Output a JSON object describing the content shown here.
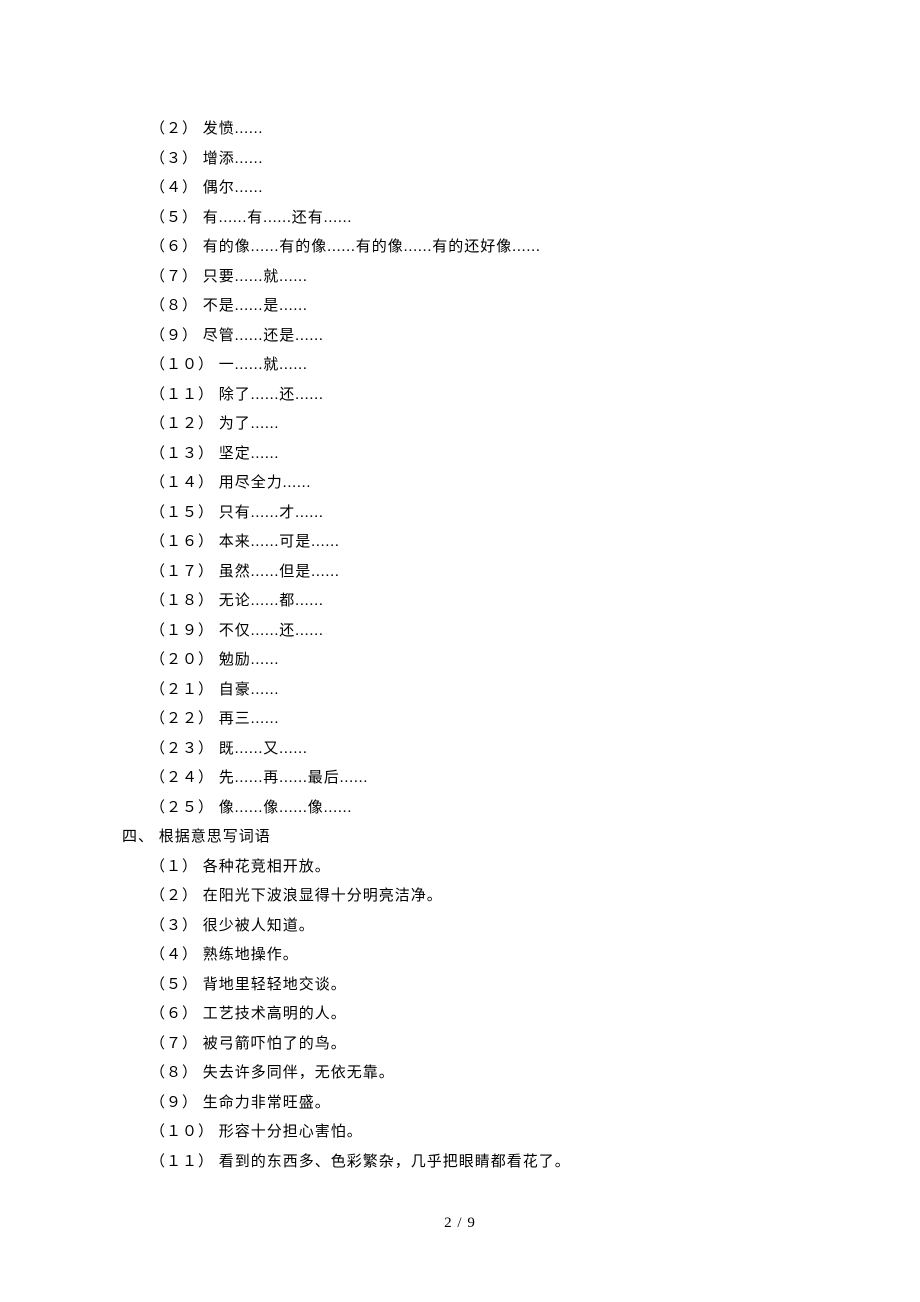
{
  "section1": {
    "items": [
      {
        "num": "（２）",
        "text": "发愤......"
      },
      {
        "num": "（３）",
        "text": "增添......"
      },
      {
        "num": "（４）",
        "text": "偶尔......"
      },
      {
        "num": "（５）",
        "text": "有......有......还有......"
      },
      {
        "num": "（６）",
        "text": "有的像......有的像......有的像......有的还好像......"
      },
      {
        "num": "（７）",
        "text": "只要......就......"
      },
      {
        "num": "（８）",
        "text": "不是......是......"
      },
      {
        "num": "（９）",
        "text": "尽管......还是......"
      },
      {
        "num": "（１０）",
        "text": "一......就......"
      },
      {
        "num": "（１１）",
        "text": "除了......还......"
      },
      {
        "num": "（１２）",
        "text": "为了......"
      },
      {
        "num": "（１３）",
        "text": "坚定......"
      },
      {
        "num": "（１４）",
        "text": "用尽全力......"
      },
      {
        "num": "（１５）",
        "text": "只有......才......"
      },
      {
        "num": "（１６）",
        "text": "本来......可是......"
      },
      {
        "num": "（１７）",
        "text": "虽然......但是......"
      },
      {
        "num": "（１８）",
        "text": "无论......都......"
      },
      {
        "num": "（１９）",
        "text": "不仅......还......"
      },
      {
        "num": "（２０）",
        "text": "勉励......"
      },
      {
        "num": "（２１）",
        "text": "自豪......"
      },
      {
        "num": "（２２）",
        "text": "再三......"
      },
      {
        "num": "（２３）",
        "text": "既......又......"
      },
      {
        "num": "（２４）",
        "text": "先......再......最后......"
      },
      {
        "num": "（２５）",
        "text": "像......像......像......"
      }
    ]
  },
  "sectionDivider": "四、 根据意思写词语",
  "section2": {
    "items": [
      {
        "num": "（１）",
        "text": "各种花竞相开放。"
      },
      {
        "num": "（２）",
        "text": "在阳光下波浪显得十分明亮洁净。"
      },
      {
        "num": "（３）",
        "text": "很少被人知道。"
      },
      {
        "num": "（４）",
        "text": "熟练地操作。"
      },
      {
        "num": "（５）",
        "text": "背地里轻轻地交谈。"
      },
      {
        "num": "（６）",
        "text": "工艺技术高明的人。"
      },
      {
        "num": "（７）",
        "text": "被弓箭吓怕了的鸟。"
      },
      {
        "num": "（８）",
        "text": "失去许多同伴，无依无靠。"
      },
      {
        "num": "（９）",
        "text": "生命力非常旺盛。"
      },
      {
        "num": "（１０）",
        "text": "形容十分担心害怕。"
      },
      {
        "num": "（１１）",
        "text": "看到的东西多、色彩繁杂，几乎把眼睛都看花了。"
      }
    ]
  },
  "pageNumber": "2 / 9"
}
